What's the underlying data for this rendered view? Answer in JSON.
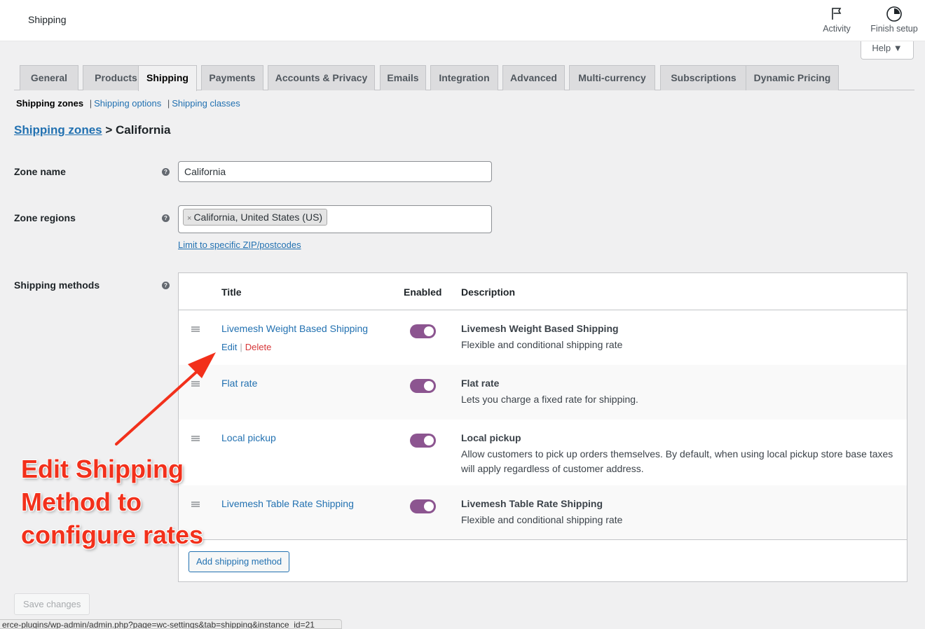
{
  "header": {
    "title": "Shipping",
    "actions": [
      {
        "label": "Activity",
        "icon": "flag-icon"
      },
      {
        "label": "Finish setup",
        "icon": "progress-circle-icon"
      }
    ],
    "help_label": "Help ▼"
  },
  "tabs": [
    {
      "label": "General",
      "active": false
    },
    {
      "label": "Products",
      "active": false
    },
    {
      "label": "Shipping",
      "active": true
    },
    {
      "label": "Payments",
      "active": false
    },
    {
      "label": "Accounts & Privacy",
      "active": false
    },
    {
      "label": "Emails",
      "active": false
    },
    {
      "label": "Integration",
      "active": false
    },
    {
      "label": "Advanced",
      "active": false
    },
    {
      "label": "Multi-currency",
      "active": false
    },
    {
      "label": "Subscriptions",
      "active": false
    },
    {
      "label": "Dynamic Pricing",
      "active": false
    }
  ],
  "subnav": {
    "current": "Shipping zones",
    "links": [
      "Shipping options",
      "Shipping classes"
    ],
    "separator": "|"
  },
  "breadcrumb": {
    "link": "Shipping zones",
    "separator": ">",
    "current": "California"
  },
  "form": {
    "zone_name": {
      "label": "Zone name",
      "value": "California"
    },
    "zone_regions": {
      "label": "Zone regions",
      "chips": [
        {
          "remove": "×",
          "label": "California, United States (US)"
        }
      ],
      "limit_link": "Limit to specific ZIP/postcodes"
    },
    "shipping_methods": {
      "label": "Shipping methods"
    }
  },
  "methods_table": {
    "columns": {
      "title": "Title",
      "enabled": "Enabled",
      "description": "Description"
    },
    "rows": [
      {
        "title": "Livemesh Weight Based Shipping",
        "enabled": true,
        "desc_title": "Livemesh Weight Based Shipping",
        "desc_text": "Flexible and conditional shipping rate",
        "actions": {
          "edit": "Edit",
          "separator": "|",
          "delete": "Delete"
        }
      },
      {
        "title": "Flat rate",
        "enabled": true,
        "desc_title": "Flat rate",
        "desc_text": "Lets you charge a fixed rate for shipping."
      },
      {
        "title": "Local pickup",
        "enabled": true,
        "desc_title": "Local pickup",
        "desc_text": "Allow customers to pick up orders themselves. By default, when using local pickup store base taxes will apply regardless of customer address."
      },
      {
        "title": "Livemesh Table Rate Shipping",
        "enabled": true,
        "desc_title": "Livemesh Table Rate Shipping",
        "desc_text": "Flexible and conditional shipping rate"
      }
    ],
    "add_button": "Add shipping method"
  },
  "save_button": "Save changes",
  "status_bar_url": "erce-plugins/wp-admin/admin.php?page=wc-settings&tab=shipping&instance_id=21",
  "annotation": {
    "lines": [
      "Edit Shipping",
      "Method to",
      "configure rates"
    ],
    "color": "#f2301b"
  },
  "colors": {
    "link": "#2271b1",
    "toggle_on": "#8c5590",
    "delete": "#d63638",
    "annotation": "#f2301b"
  }
}
